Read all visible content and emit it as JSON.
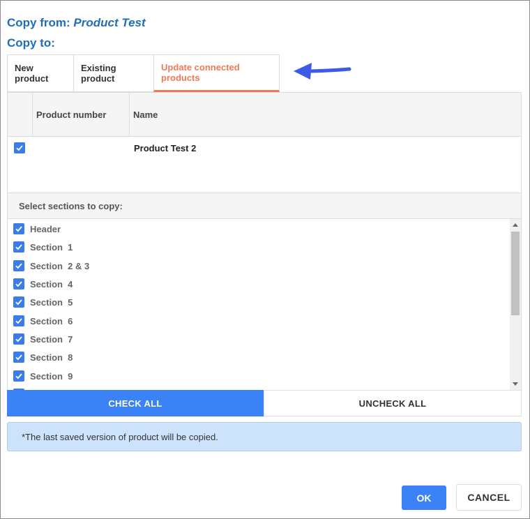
{
  "header": {
    "copy_from_label": "Copy from:",
    "copy_from_product": "Product Test",
    "copy_to_label": "Copy to:"
  },
  "tabs": [
    {
      "label": "New product",
      "active": false
    },
    {
      "label": "Existing product",
      "active": false
    },
    {
      "label": "Update connected products",
      "active": true
    }
  ],
  "grid": {
    "columns": [
      "",
      "Product number",
      "Name"
    ],
    "rows": [
      {
        "checked": true,
        "product_number": "",
        "name": "Product Test 2"
      }
    ]
  },
  "sections": {
    "heading": "Select sections to copy:",
    "items": [
      {
        "label": "Header",
        "checked": true
      },
      {
        "label": "Section  1",
        "checked": true
      },
      {
        "label": "Section  2 & 3",
        "checked": true
      },
      {
        "label": "Section  4",
        "checked": true
      },
      {
        "label": "Section  5",
        "checked": true
      },
      {
        "label": "Section  6",
        "checked": true
      },
      {
        "label": "Section  7",
        "checked": true
      },
      {
        "label": "Section  8",
        "checked": true
      },
      {
        "label": "Section  9",
        "checked": true
      }
    ]
  },
  "buttons": {
    "check_all": "CHECK ALL",
    "uncheck_all": "UNCHECK ALL",
    "ok": "OK",
    "cancel": "CANCEL"
  },
  "note": "*The last saved version of product will be copied.",
  "colors": {
    "title": "#1f6fb8",
    "active_tab": "#f07a55",
    "primary": "#3b82f6",
    "checkbox": "#3b7ce8",
    "note_bg": "#cce3fb",
    "annotation_arrow": "#3b5ce8"
  },
  "icons": {
    "checkbox": "checkmark-icon",
    "annotation": "arrow-left-icon"
  }
}
